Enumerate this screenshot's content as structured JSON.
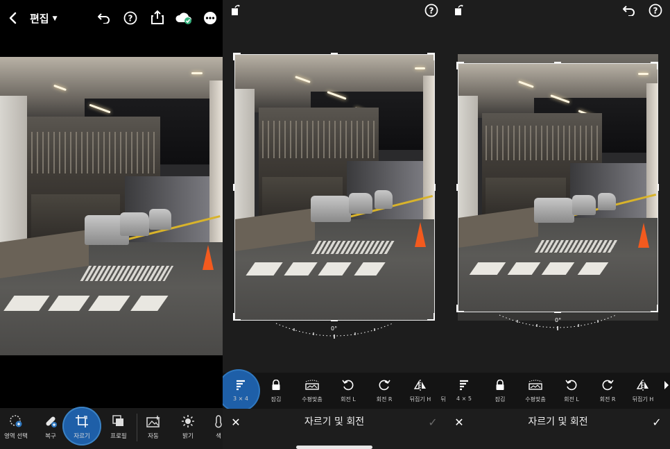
{
  "panel_edit": {
    "title": "편집",
    "header_icons": [
      "back-arrow-icon",
      "undo-icon",
      "help-icon",
      "share-icon",
      "cloud-sync-icon",
      "more-icon"
    ],
    "tools": [
      {
        "label": "영역 선택",
        "icon": "select-area-icon"
      },
      {
        "label": "복구",
        "icon": "healing-icon"
      },
      {
        "label": "자르기",
        "icon": "crop-icon",
        "active": true
      },
      {
        "label": "프로필",
        "icon": "profiles-icon"
      },
      {
        "label": "자동",
        "icon": "auto-icon"
      },
      {
        "label": "밝기",
        "icon": "brightness-icon"
      },
      {
        "label": "색",
        "icon": "color-icon"
      }
    ]
  },
  "panel_crop_3x4": {
    "angle": "0°",
    "options": [
      {
        "label": "3 × 4",
        "icon": "aspect-icon",
        "active": true
      },
      {
        "label": "잠김",
        "icon": "lock-icon"
      },
      {
        "label": "수평맞춤",
        "icon": "straighten-icon"
      },
      {
        "label": "회전 L",
        "icon": "rotate-left-icon"
      },
      {
        "label": "회전 R",
        "icon": "rotate-right-icon"
      },
      {
        "label": "뒤집기 H",
        "icon": "flip-horizontal-icon"
      }
    ],
    "title": "자르기 및 회전"
  },
  "panel_crop_4x5": {
    "angle": "0°",
    "options": [
      {
        "label": "4 × 5",
        "icon": "aspect-icon"
      },
      {
        "label": "잠김",
        "icon": "lock-icon"
      },
      {
        "label": "수평맞춤",
        "icon": "straighten-icon"
      },
      {
        "label": "회전 L",
        "icon": "rotate-left-icon"
      },
      {
        "label": "회전 R",
        "icon": "rotate-right-icon"
      },
      {
        "label": "뒤집기 H",
        "icon": "flip-horizontal-icon"
      }
    ],
    "title": "자르기 및 회전"
  },
  "colors": {
    "accent": "#1e5fa8",
    "toolbar_bg": "#1a1a1a",
    "panel_bg": "#1d1d1d",
    "confirm_disabled": "#6a6a6a"
  }
}
